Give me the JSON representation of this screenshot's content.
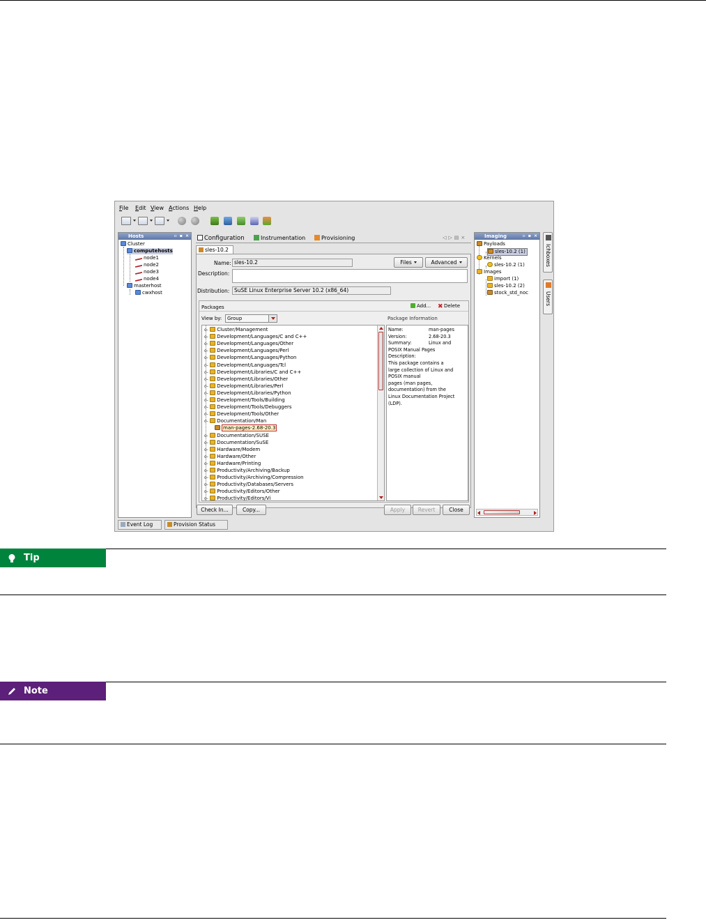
{
  "menu": [
    "File",
    "Edit",
    "View",
    "Actions",
    "Help"
  ],
  "hosts_panel": {
    "title": "Hosts",
    "tree": [
      "Cluster",
      "computehosts",
      "node1",
      "node2",
      "node3",
      "node4",
      "masterhost",
      "cwxhost"
    ]
  },
  "main_tabs": [
    "Configuration",
    "Instrumentation",
    "Provisioning"
  ],
  "doc_tab": "sles-10.2",
  "form": {
    "name_label": "Name:",
    "name_value": "sles-10.2",
    "description_label": "Description:",
    "description_value": "",
    "distribution_label": "Distribution:",
    "distribution_value": "SuSE Linux Enterprise Server 10.2 (x86_64)",
    "files_button": "Files",
    "advanced_button": "Advanced"
  },
  "packages": {
    "title": "Packages",
    "add_label": "Add...",
    "delete_label": "Delete",
    "view_by_label": "View by:",
    "view_by_value": "Group",
    "groups": [
      "Cluster/Management",
      "Development/Languages/C and C++",
      "Development/Languages/Other",
      "Development/Languages/Perl",
      "Development/Languages/Python",
      "Development/Languages/Tcl",
      "Development/Libraries/C and C++",
      "Development/Libraries/Other",
      "Development/Libraries/Perl",
      "Development/Libraries/Python",
      "Development/Tools/Building",
      "Development/Tools/Debuggers",
      "Development/Tools/Other",
      "Documentation/Man"
    ],
    "selected_package": "man-pages-2.68-20.3",
    "groups_after": [
      "Documentation/SUSE",
      "Documentation/SuSE",
      "Hardware/Modem",
      "Hardware/Other",
      "Hardware/Printing",
      "Productivity/Archiving/Backup",
      "Productivity/Archiving/Compression",
      "Productivity/Databases/Servers",
      "Productivity/Editors/Other",
      "Productivity/Editors/Vi"
    ],
    "info": {
      "header": "Package Information",
      "name_label": "Name:",
      "name_value": "man-pages",
      "version_label": "Version:",
      "version_value": "2.68-20.3",
      "summary_label": "Summary:",
      "summary_value_1": "Linux and",
      "summary_value_2": "POSIX Manual Pages",
      "description_label": "Description:",
      "description_lines": [
        "This package contains a",
        "large collection of Linux and",
        "POSIX manual",
        "pages (man pages,",
        "documentation) from the",
        "Linux Documentation Project",
        "(LDP)."
      ]
    }
  },
  "bottom_buttons": {
    "check_in": "Check In...",
    "copy": "Copy...",
    "apply": "Apply",
    "revert": "Revert",
    "close": "Close"
  },
  "imaging_panel": {
    "title": "Imaging",
    "tree": [
      "Payloads",
      "sles-10.2 (1)",
      "Kernels",
      "sles-10.2 (1)",
      "Images",
      "import (1)",
      "sles-10.2 (2)",
      "stock_std_noc"
    ]
  },
  "side_tabs": [
    "Ichboxes",
    "Users"
  ],
  "bottom_tabs": [
    "Event Log",
    "Provision Status"
  ],
  "callouts": {
    "tip": "Tip",
    "note": "Note",
    "tip_color": "#00843d",
    "note_color": "#5c1f7a"
  }
}
